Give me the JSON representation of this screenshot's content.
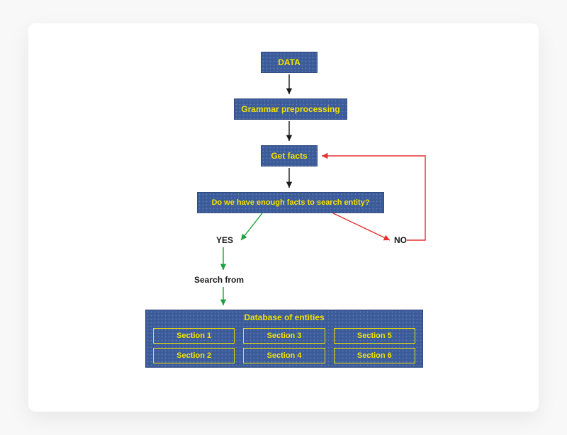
{
  "flow": {
    "nodes": {
      "data": "DATA",
      "preprocess": "Grammar preprocessing",
      "get_facts": "Get facts",
      "decision": "Do we have enough facts to search entity?"
    },
    "branches": {
      "yes": "YES",
      "no": "NO",
      "search_from": "Search from"
    },
    "database": {
      "title": "Database of entities",
      "sections": [
        "Section 1",
        "Section 2",
        "Section 3",
        "Section 4",
        "Section 5",
        "Section 6"
      ]
    }
  }
}
